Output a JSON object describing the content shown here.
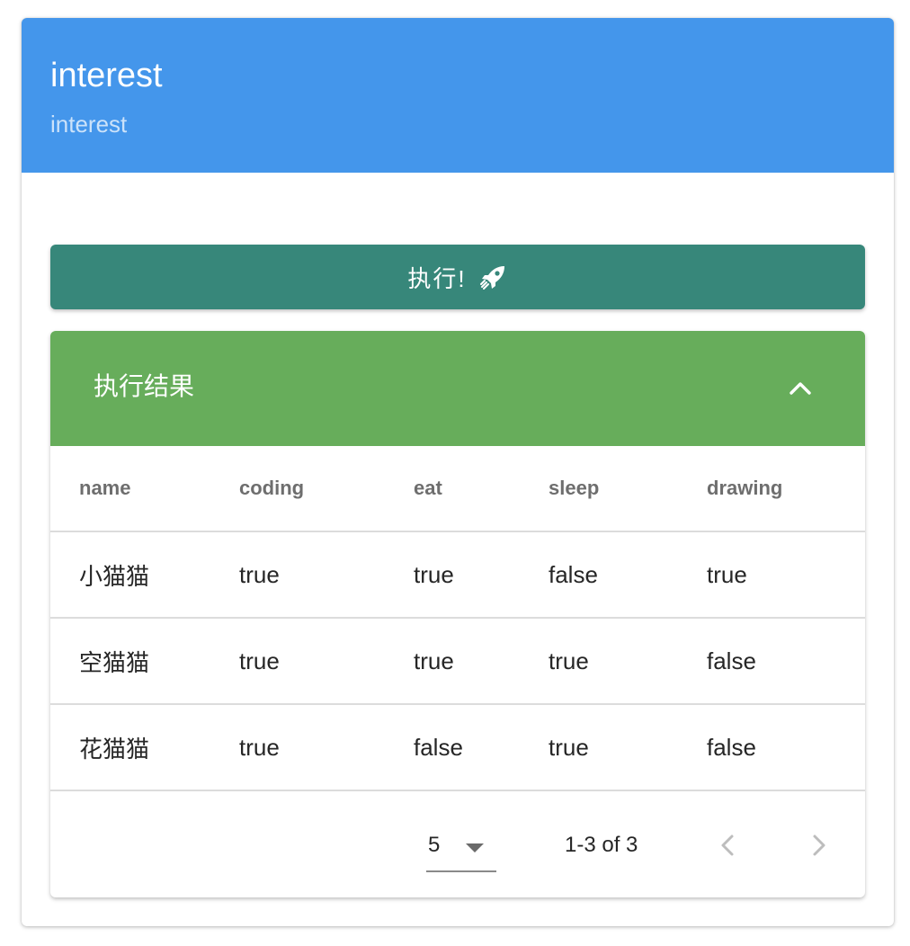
{
  "card": {
    "title": "interest",
    "subtitle": "interest",
    "header_color": "#4496eb"
  },
  "run_button": {
    "label": "执行!",
    "icon": "rocket-icon",
    "color": "#37877a"
  },
  "results": {
    "title": "执行结果",
    "header_color": "#67ad5b",
    "toggle_icon": "chevron-up-icon",
    "columns": [
      "name",
      "coding",
      "eat",
      "sleep",
      "drawing"
    ],
    "rows": [
      [
        "小猫猫",
        "true",
        "true",
        "false",
        "true"
      ],
      [
        "空猫猫",
        "true",
        "true",
        "true",
        "false"
      ],
      [
        "花猫猫",
        "true",
        "false",
        "true",
        "false"
      ]
    ]
  },
  "pagination": {
    "rows_per_page": "5",
    "range": "1-3 of 3",
    "prev_icon": "chevron-left-icon",
    "next_icon": "chevron-right-icon"
  }
}
